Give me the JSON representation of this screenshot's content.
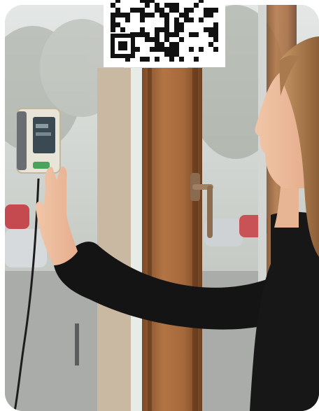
{
  "photo": {
    "subject": "woman-touching-wall-sensor",
    "icons": [
      "qr-code-icon",
      "sensor-device-icon",
      "door-handle-icon"
    ],
    "colors": {
      "wood_frame": "#a86a3a",
      "sweater": "#151414",
      "hair": "#b98a5a",
      "device_body": "#e9e4d8",
      "device_screen": "#3b4a52",
      "device_button": "#4aa35c"
    }
  }
}
